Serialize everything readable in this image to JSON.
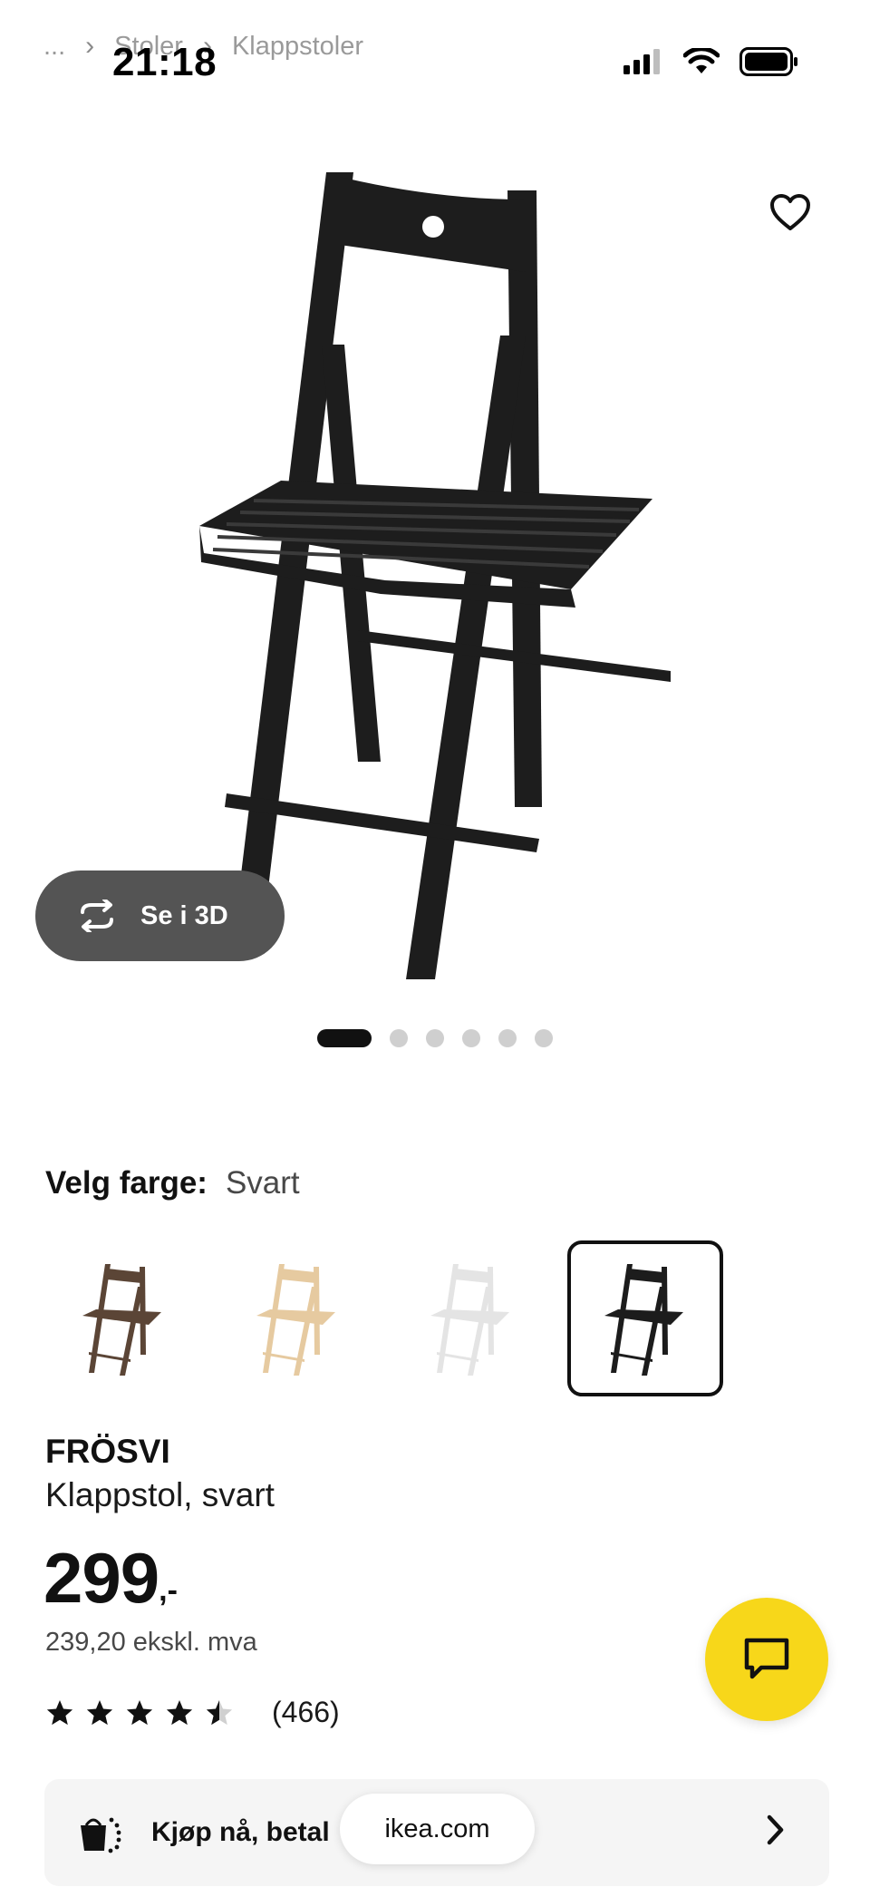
{
  "status_bar": {
    "time": "21:18",
    "icons": [
      "signal-icon",
      "wifi-icon",
      "battery-icon"
    ]
  },
  "breadcrumb": {
    "items": [
      "...",
      "Stoler",
      "Klappstoler"
    ]
  },
  "hero": {
    "btn_3d_label": "Se i 3D",
    "carousel_total": 6,
    "carousel_active": 0
  },
  "color": {
    "label": "Velg farge:",
    "value": "Svart",
    "swatches": [
      {
        "name": "brown",
        "hex": "#5b4536",
        "selected": false
      },
      {
        "name": "birch",
        "hex": "#e6caa0",
        "selected": false
      },
      {
        "name": "white",
        "hex": "#ececec",
        "selected": false
      },
      {
        "name": "black",
        "hex": "#1c1c1c",
        "selected": true
      }
    ]
  },
  "product": {
    "name": "FRÖSVI",
    "description": "Klappstol, svart",
    "price": "299",
    "price_suffix": ",-",
    "ex_vat": "239,20 ekskl. mva",
    "rating": 4.5,
    "rating_max": 5,
    "reviews": "(466)"
  },
  "pay_banner": {
    "text": "Kjøp nå, betal"
  },
  "browser": {
    "url": "ikea.com"
  },
  "colors": {
    "accent_yellow": "#f7d71a",
    "pill_dark": "#545454"
  }
}
